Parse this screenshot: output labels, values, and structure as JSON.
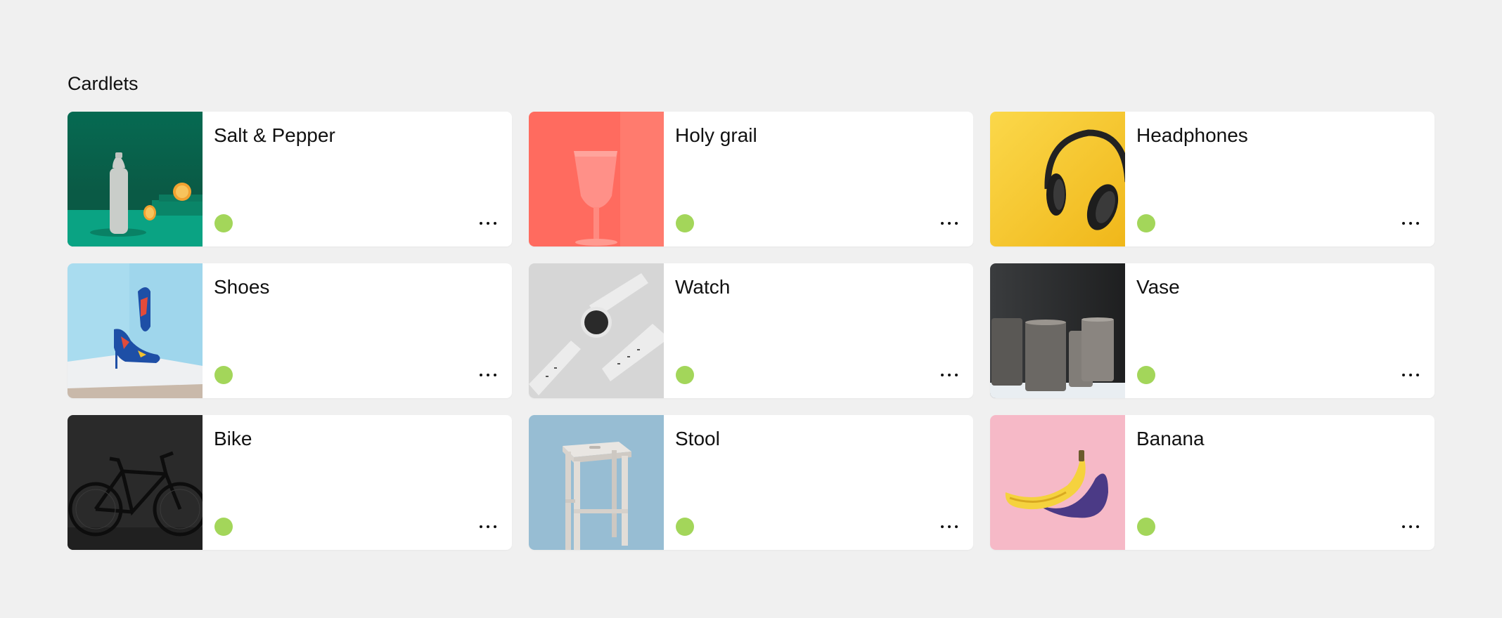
{
  "section": {
    "title": "Cardlets"
  },
  "status_color": "#a3d65a",
  "cards": [
    {
      "title": "Salt & Pepper",
      "image": "salt-pepper-image",
      "background": "#0b7a5f"
    },
    {
      "title": "Holy grail",
      "image": "holy-grail-image",
      "background": "#ff6b5f"
    },
    {
      "title": "Headphones",
      "image": "headphones-image",
      "background": "#f7cf2e"
    },
    {
      "title": "Shoes",
      "image": "shoes-image",
      "background": "#a9dcef"
    },
    {
      "title": "Watch",
      "image": "watch-image",
      "background": "#d6d6d6"
    },
    {
      "title": "Vase",
      "image": "vase-image",
      "background": "#2e3032"
    },
    {
      "title": "Bike",
      "image": "bike-image",
      "background": "#2a2a2a"
    },
    {
      "title": "Stool",
      "image": "stool-image",
      "background": "#97bdd3"
    },
    {
      "title": "Banana",
      "image": "banana-image",
      "background": "#f6b9c7"
    }
  ]
}
